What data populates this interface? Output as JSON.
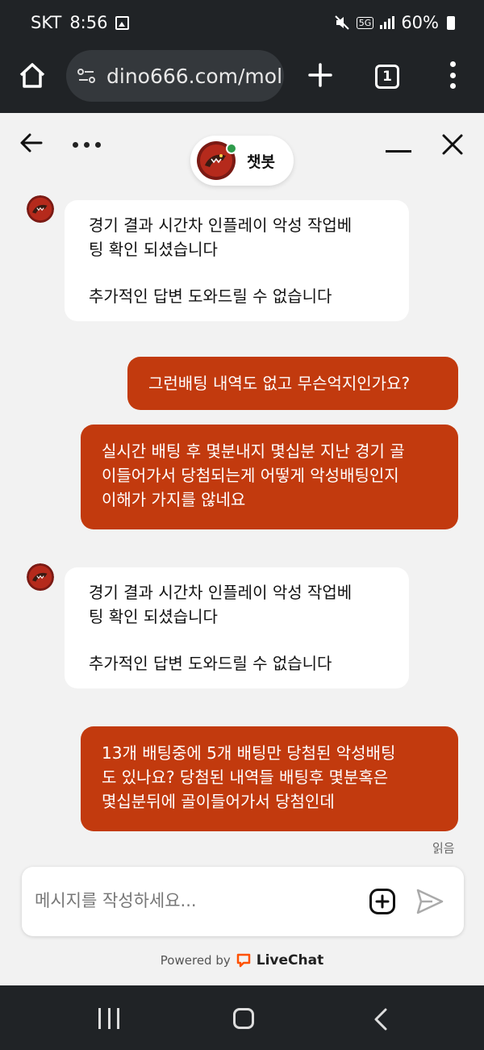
{
  "status": {
    "carrier": "SKT",
    "time": "8:56",
    "network": "5G",
    "battery": "60%"
  },
  "browser": {
    "url": "dino666.com/mol",
    "tab_count": "1"
  },
  "chat": {
    "agent_name": "챗봇",
    "messages": [
      {
        "from": "agent",
        "lines": [
          "경기 결과 시간차 인플레이 악성 작업베",
          "팅 확인 되셨습니다",
          "",
          "추가적인 답변 도와드릴 수 없습니다"
        ]
      },
      {
        "from": "user",
        "lines": [
          "그런배팅 내역도 없고 무슨억지인가요?"
        ]
      },
      {
        "from": "user",
        "lines": [
          "실시간 배팅 후 몇분내지 몇십분 지난 경기 골",
          "이들어가서 당첨되는게 어떻게 악성배팅인지",
          "이해가 가지를 않네요"
        ]
      },
      {
        "from": "agent",
        "lines": [
          "경기 결과 시간차 인플레이 악성 작업베",
          "팅 확인 되셨습니다",
          "",
          "추가적인 답변 도와드릴 수 없습니다"
        ]
      },
      {
        "from": "user",
        "lines": [
          "13개 배팅중에 5개 배팅만 당첨된 악성배팅",
          "도 있나요? 당첨된 내역들 배팅후 몇분혹은",
          "몇십분뒤에 골이들어가서 당첨인데"
        ]
      }
    ],
    "read_receipt": "읽음"
  },
  "composer": {
    "placeholder": "메시지를 작성하세요..."
  },
  "footer": {
    "powered_by": "Powered by",
    "brand": "LiveChat"
  },
  "colors": {
    "user_bubble": "#c23a0e",
    "agent_bubble": "#ffffff",
    "online": "#2e9b4b",
    "livechat_orange": "#ff5100"
  }
}
